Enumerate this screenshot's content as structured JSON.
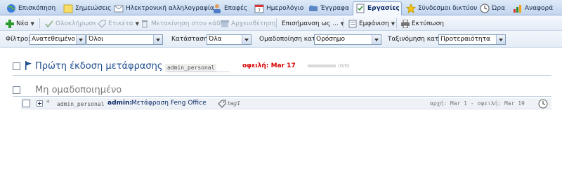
{
  "tabs": [
    {
      "label": "Επισκόπηση",
      "icon": "globe-icon"
    },
    {
      "label": "Σημειώσεις",
      "icon": "note-icon"
    },
    {
      "label": "Ηλεκτρονική αλληλογραφία",
      "icon": "mail-icon"
    },
    {
      "label": "Επαφές",
      "icon": "contacts-icon"
    },
    {
      "label": "Ημερολόγιο",
      "icon": "calendar-icon"
    },
    {
      "label": "Έγγραφα",
      "icon": "documents-icon"
    },
    {
      "label": "Εργασίες",
      "icon": "tasks-icon",
      "active": true
    },
    {
      "label": "Σύνδεσμοι δικτύου",
      "icon": "star-icon"
    },
    {
      "label": "Ώρα",
      "icon": "clock-icon"
    },
    {
      "label": "Αναφορά",
      "icon": "chart-icon"
    }
  ],
  "toolbar": {
    "new_label": "Νέα",
    "complete_label": "Ολοκλήρωσε",
    "tag_label": "Ετικέτα",
    "trash_label": "Μετακίνηση στον κάδο",
    "archive_label": "Αρχειοθέτηση",
    "mark_label": "Επισήμανση ως ...",
    "view_label": "Εμφάνιση",
    "print_label": "Εκτύπωση"
  },
  "filters": {
    "filter_label": "Φίλτρο:",
    "filter_value": "Ανατεθειμένο σ",
    "filter_value2": "Όλοι",
    "status_label": "Κατάσταση:",
    "status_value": "Όλα",
    "group_label": "Ομαδοποίηση κατά:",
    "group_value": "Ορόσημο",
    "sort_label": "Ταξινόμηση κατά:",
    "sort_value": "Προτεραιότητα"
  },
  "groups": [
    {
      "title": "Πρώτη έκδοση μετάφρασης",
      "workspace": "admin_personal",
      "due": "οφειλή: Mar 17",
      "progress_text": "(0/0)",
      "progress": 0
    },
    {
      "title": "Μη ομαδοποιημένο"
    }
  ],
  "task": {
    "star": "*",
    "workspace": "admin_personal",
    "assignee": "admin:",
    "title": "Μετάφραση Feng Office",
    "tag": "tag1",
    "dates": "αρχή: Mar 1 - οφειλή: Mar 19"
  },
  "colors": {
    "accent": "#1e4e8c",
    "due": "#d40000",
    "tab_bar": "#c2d6ee"
  }
}
